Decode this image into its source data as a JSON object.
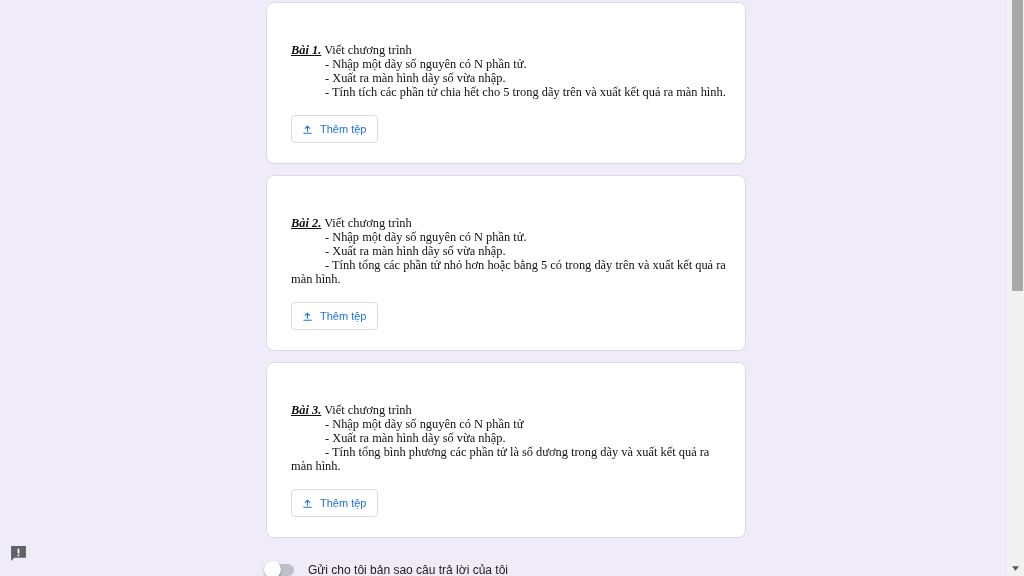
{
  "questions": [
    {
      "label": "Bài 1.",
      "title": "Viết chương trình",
      "lines": [
        "- Nhập một dãy số nguyên có N phần tử.",
        "- Xuất ra màn hình dãy số vừa nhập.",
        "- Tính tích các phần tử chia hết cho 5 trong dãy trên và xuất kết quả ra màn hình."
      ],
      "button": "Thêm tệp"
    },
    {
      "label": "Bài 2.",
      "title": "Viết chương trình",
      "lines": [
        "- Nhập một dãy số nguyên có N phần tử.",
        "- Xuất ra màn hình dãy số vừa nhập.",
        "- Tính tổng các phần tử nhỏ hơn hoặc bằng 5 có trong dãy trên và xuất kết quả ra màn hình."
      ],
      "button": "Thêm tệp"
    },
    {
      "label": "Bài 3.",
      "title": "Viết chương trình",
      "lines": [
        "- Nhập một dãy số nguyên có N phần tử",
        "- Xuất ra màn hình dãy số vừa nhập.",
        "- Tính tổng bình phương các phần tử là số dương trong dãy và xuất kết quả ra màn hình."
      ],
      "button": "Thêm tệp"
    }
  ],
  "send_copy": {
    "label": "Gửi cho tôi bản sao câu trả lời của tôi",
    "on": false
  }
}
